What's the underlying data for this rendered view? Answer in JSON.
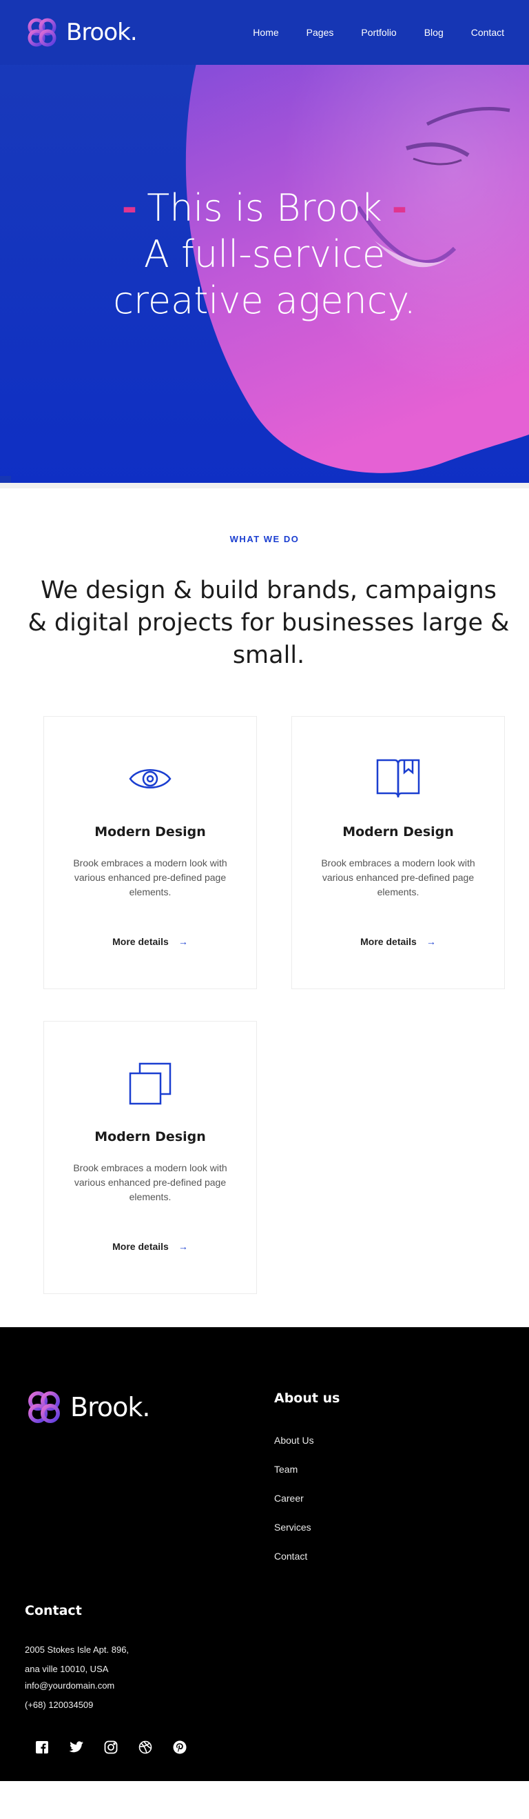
{
  "brand": {
    "name": "Brook."
  },
  "nav": {
    "items": [
      {
        "label": "Home"
      },
      {
        "label": "Pages"
      },
      {
        "label": "Portfolio"
      },
      {
        "label": "Blog"
      },
      {
        "label": "Contact"
      }
    ]
  },
  "hero": {
    "line1": "This is Brook",
    "line1_dash_left": "-",
    "line1_dash_right": "-",
    "line2": "A full-service",
    "line3": "creative agency."
  },
  "section": {
    "eyebrow": "WHAT WE DO",
    "headline": "We design & build brands, campaigns & digital projects for businesses large & small."
  },
  "cards": [
    {
      "icon": "eye-icon",
      "title": "Modern Design",
      "description": "Brook embraces a modern look with various enhanced pre-defined page elements.",
      "link": "More details"
    },
    {
      "icon": "book-icon",
      "title": "Modern Design",
      "description": "Brook embraces a modern look with various enhanced pre-defined page elements.",
      "link": "More details"
    },
    {
      "icon": "copy-icon",
      "title": "Modern Design",
      "description": "Brook embraces a modern look with various enhanced pre-defined page elements.",
      "link": "More details"
    }
  ],
  "footer": {
    "brand": "Brook.",
    "about_title": "About us",
    "about_links": [
      "About Us",
      "Team",
      "Career",
      "Services",
      "Contact"
    ],
    "contact_title": "Contact",
    "contact_lines": [
      "2005 Stokes Isle Apt. 896,",
      "ana ville 10010, USA",
      "info@yourdomain.com",
      "(+68) 120034509"
    ],
    "socials": [
      "facebook-icon",
      "twitter-icon",
      "instagram-icon",
      "dribbble-icon",
      "pinterest-icon"
    ]
  },
  "colors": {
    "primary": "#1636b4",
    "accent": "#e0358f",
    "link_blue": "#1a3ed0",
    "footer_bg": "#000000"
  }
}
